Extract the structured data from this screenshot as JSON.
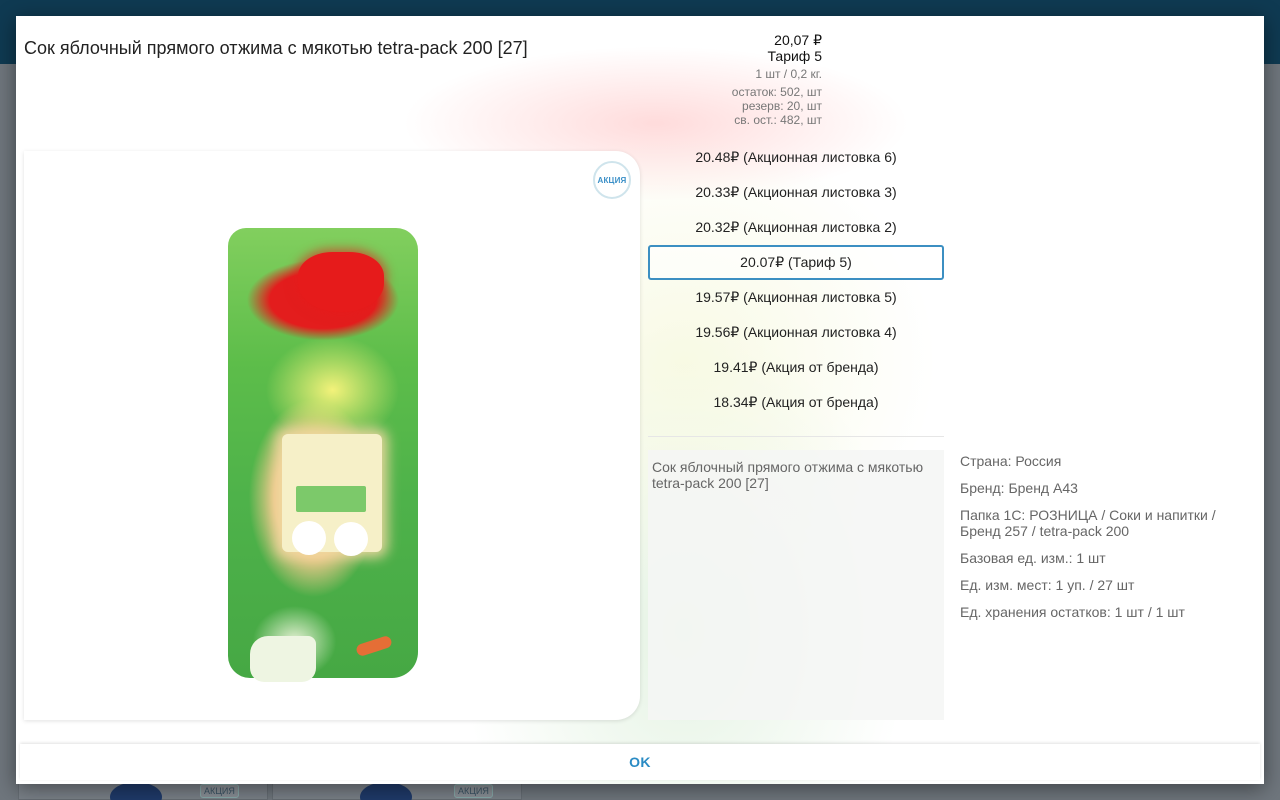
{
  "background": {
    "badges": [
      "АКЦИЯ",
      "АКЦИЯ"
    ]
  },
  "dialog": {
    "title": "Сок яблочный прямого отжима с мякотью tetra-pack 200 [27]",
    "price": {
      "main": "20,07 ₽",
      "tariff": "Тариф 5",
      "unit": "1 шт / 0,2 кг.",
      "stock": "остаток: 502, шт",
      "reserve": "резерв: 20, шт",
      "free_stock": "св. ост.: 482, шт"
    },
    "image": {
      "promo_badge": "АКЦИЯ"
    },
    "price_options": [
      {
        "label": "20.48₽ (Акционная листовка 6)",
        "selected": false
      },
      {
        "label": "20.33₽ (Акционная листовка 3)",
        "selected": false
      },
      {
        "label": "20.32₽ (Акционная листовка 2)",
        "selected": false
      },
      {
        "label": "20.07₽ (Тариф 5)",
        "selected": true
      },
      {
        "label": "19.57₽ (Акционная листовка 5)",
        "selected": false
      },
      {
        "label": "19.56₽ (Акционная листовка 4)",
        "selected": false
      },
      {
        "label": "19.41₽ (Акция от бренда)",
        "selected": false
      },
      {
        "label": "18.34₽ (Акция от бренда)",
        "selected": false
      }
    ],
    "description": "Сок яблочный прямого отжима с мякотью tetra-pack 200 [27]",
    "properties": [
      "Страна: Россия",
      "Бренд: Бренд А43",
      "Папка 1С: РОЗНИЦА / Соки и напитки / Бренд 257 / tetra-pack 200",
      "Базовая ед. изм.: 1 шт",
      "Ед. изм. мест: 1 уп. / 27 шт",
      "Ед. хранения остатков: 1 шт / 1 шт"
    ],
    "ok_label": "OK"
  },
  "colors": {
    "accent": "#2a8bc4",
    "appbar": "#0f3a52",
    "selected_border": "#3c8fc2"
  }
}
